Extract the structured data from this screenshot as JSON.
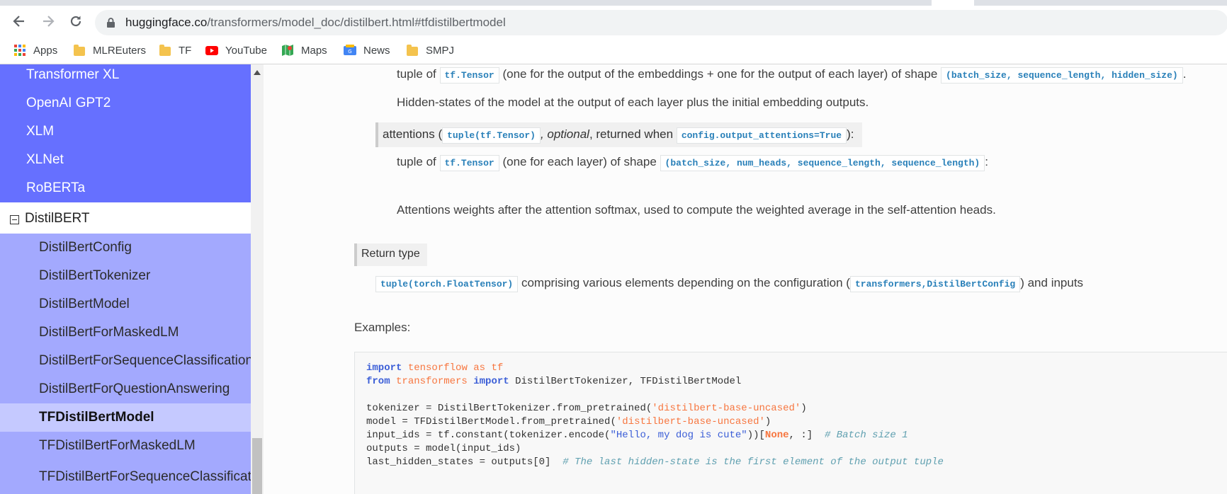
{
  "browser": {
    "url_host": "huggingface.co",
    "url_path": "/transformers/model_doc/distilbert.html#tfdistilbertmodel"
  },
  "bookmarks": [
    {
      "label": "Apps",
      "icon": "apps-grid-icon"
    },
    {
      "label": "MLREuters",
      "icon": "folder-icon"
    },
    {
      "label": "TF",
      "icon": "folder-icon"
    },
    {
      "label": "YouTube",
      "icon": "youtube-icon"
    },
    {
      "label": "Maps",
      "icon": "maps-icon"
    },
    {
      "label": "News",
      "icon": "news-icon"
    },
    {
      "label": "SMPJ",
      "icon": "folder-icon"
    }
  ],
  "sidebar": {
    "top_items": [
      "Transformer XL",
      "OpenAI GPT2",
      "XLM",
      "XLNet",
      "RoBERTa"
    ],
    "section": "DistilBERT",
    "sub_items": [
      "DistilBertConfig",
      "DistilBertTokenizer",
      "DistilBertModel",
      "DistilBertForMaskedLM",
      "DistilBertForSequenceClassification",
      "DistilBertForQuestionAnswering",
      "TFDistilBertModel",
      "TFDistilBertForMaskedLM",
      "TFDistilBertForSequenceClassification"
    ],
    "current": "TFDistilBertModel"
  },
  "content": {
    "hidden_states": {
      "prefix": "tuple of",
      "code1": "tf.Tensor",
      "middle": "(one for the output of the embeddings + one for the output of each layer) of shape",
      "code2": "(batch_size, sequence_length, hidden_size)",
      "suffix": ".",
      "description": "Hidden-states of the model at the output of each layer plus the initial embedding outputs."
    },
    "attentions": {
      "label_name": "attentions (",
      "label_type": "tuple(tf.Tensor)",
      "label_optional": ", optional",
      "label_returned": ", returned when",
      "label_config": "config.output_attentions=True",
      "label_end": "):",
      "prefix": "tuple of",
      "code1": "tf.Tensor",
      "middle": "(one for each layer) of shape",
      "code2": "(batch_size, num_heads, sequence_length, sequence_length)",
      "suffix": ":",
      "description": "Attentions weights after the attention softmax, used to compute the weighted average in the self-attention heads."
    },
    "return_type": {
      "label": "Return type",
      "code1": "tuple(torch.FloatTensor)",
      "middle": "comprising various elements depending on the configuration (",
      "code2": "transformers,DistilBertConfig",
      "suffix": ") and inputs"
    },
    "examples_label": "Examples:",
    "code": {
      "l1_kw": "import",
      "l1_mod": "tensorflow",
      "l1_as": "as",
      "l1_alias": "tf",
      "l2_from": "from",
      "l2_mod": "transformers",
      "l2_import": "import",
      "l2_rest": "DistilBertTokenizer, TFDistilBertModel",
      "l4_a": "tokenizer = DistilBertTokenizer.from_pretrained(",
      "l4_s": "'distilbert-base-uncased'",
      "l4_b": ")",
      "l5_a": "model = TFDistilBertModel.from_pretrained(",
      "l5_s": "'distilbert-base-uncased'",
      "l5_b": ")",
      "l6_a": "input_ids = tf.constant(tokenizer.encode(",
      "l6_s": "\"Hello, my dog is cute\"",
      "l6_b": "))[",
      "l6_none": "None",
      "l6_c": ", :]  ",
      "l6_cmt": "# Batch size 1",
      "l7": "outputs = model(input_ids)",
      "l8_a": "last_hidden_states = outputs[0]  ",
      "l8_cmt": "# The last hidden-state is the first element of the output tuple"
    }
  }
}
